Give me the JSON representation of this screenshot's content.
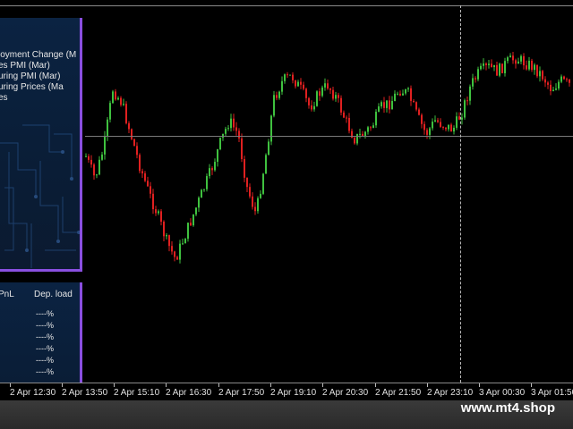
{
  "news_panel": {
    "items": [
      "loyment Change (M",
      "es PMI (Mar)",
      "uring PMI (Mar)",
      "uring Prices (Ma",
      "es"
    ]
  },
  "pnl_panel": {
    "col_pnl": "PnL",
    "col_load": "Dep. load",
    "values": [
      "----%",
      "----%",
      "----%",
      "----%",
      "----%",
      "----%"
    ]
  },
  "time_axis": {
    "labels": [
      "2 Apr 12:30",
      "2 Apr 13:50",
      "2 Apr 15:10",
      "2 Apr 16:30",
      "2 Apr 17:50",
      "2 Apr 19:10",
      "2 Apr 20:30",
      "2 Apr 21:50",
      "2 Apr 23:10",
      "3 Apr 00:30",
      "3 Apr 01:50"
    ]
  },
  "brand": {
    "text": "www.mt4.shop"
  },
  "colors": {
    "bull": "#3fc13f",
    "bear": "#e02020",
    "panel_border": "#8a4fe0",
    "background": "#000000"
  },
  "price_trace": [
    175,
    200,
    165,
    100,
    115,
    150,
    185,
    215,
    240,
    270,
    290,
    265,
    240,
    215,
    190,
    160,
    135,
    150,
    210,
    240,
    180,
    110,
    90,
    85,
    100,
    120,
    105,
    95,
    110,
    135,
    155,
    150,
    140,
    120,
    115,
    100,
    105,
    130,
    150,
    135,
    140,
    145,
    125,
    95,
    80,
    75,
    80,
    70,
    65,
    70,
    75,
    85,
    100,
    90,
    95
  ]
}
